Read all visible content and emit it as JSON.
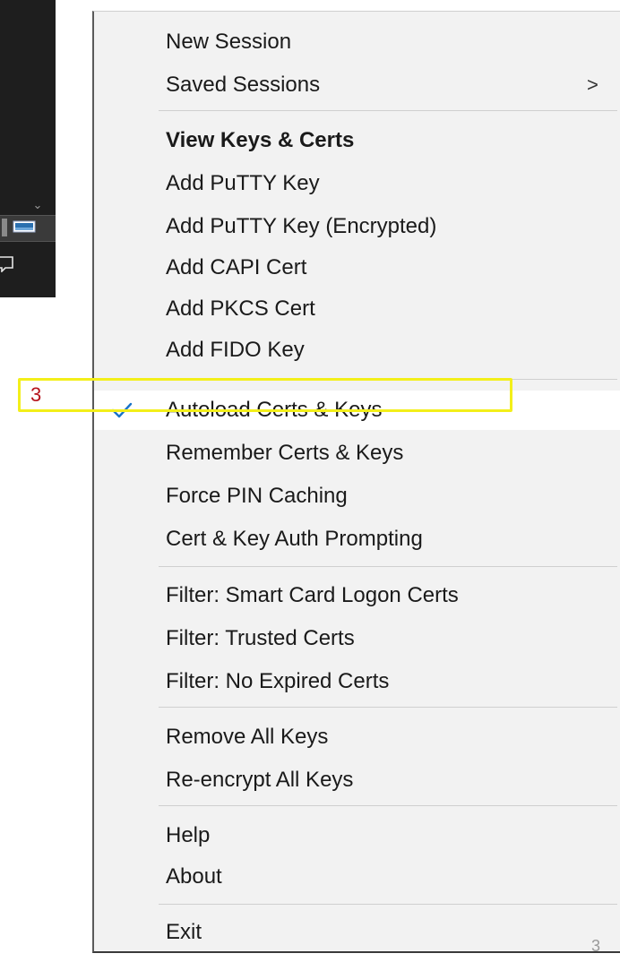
{
  "menu": {
    "items": [
      {
        "label": "New Session"
      },
      {
        "label": "Saved Sessions",
        "submenu_icon": "chevron-right-icon",
        "chevron": ">"
      },
      {
        "label": "View Keys & Certs",
        "bold": true
      },
      {
        "label": "Add PuTTY Key"
      },
      {
        "label": "Add PuTTY Key (Encrypted)"
      },
      {
        "label": "Add CAPI Cert"
      },
      {
        "label": "Add PKCS Cert"
      },
      {
        "label": "Add FIDO Key"
      },
      {
        "label": "Autoload Certs & Keys",
        "checked": true
      },
      {
        "label": "Remember Certs & Keys"
      },
      {
        "label": "Force PIN Caching"
      },
      {
        "label": "Cert & Key Auth Prompting"
      },
      {
        "label": "Filter: Smart Card Logon Certs"
      },
      {
        "label": "Filter: Trusted Certs"
      },
      {
        "label": "Filter: No Expired Certs"
      },
      {
        "label": "Remove All Keys"
      },
      {
        "label": "Re-encrypt All Keys"
      },
      {
        "label": "Help"
      },
      {
        "label": "About"
      },
      {
        "label": "Exit"
      }
    ]
  },
  "annotation": {
    "callout_number": "3",
    "highlight_color": "#f3ef1a",
    "callout_color": "#b5121b"
  },
  "page_number": "3",
  "colors": {
    "menu_background": "#f2f2f2",
    "check_color": "#1a73c8"
  }
}
